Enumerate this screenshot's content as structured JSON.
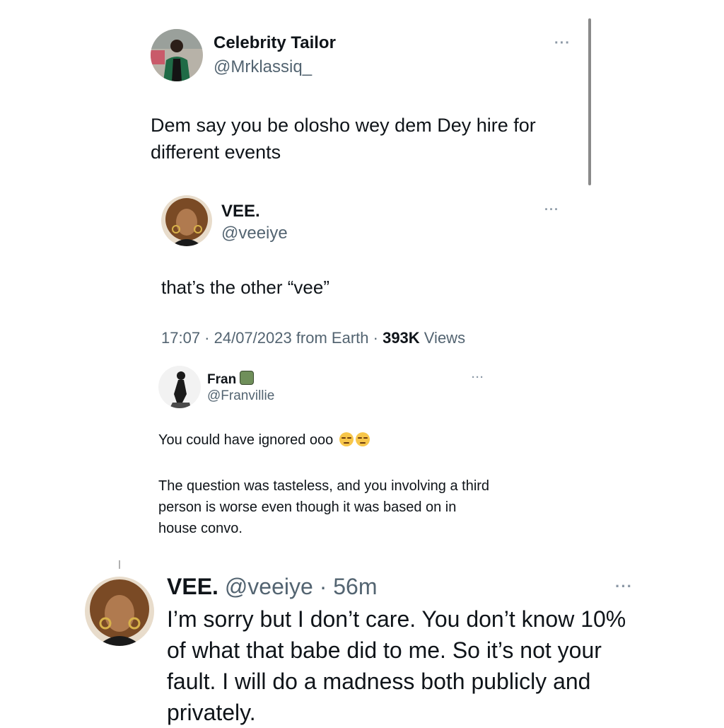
{
  "tweet1": {
    "name": "Celebrity Tailor",
    "handle": "@Mrklassiq_",
    "text": "Dem say you be olosho wey dem Dey hire for different events",
    "more_icon": "more-horizontal-icon"
  },
  "tweet2": {
    "name": "VEE.",
    "handle": "@veeiye",
    "text": "that’s the other “vee”",
    "meta_prefix": "17:07 · 24/07/2023 from Earth · ",
    "views_count": "393K",
    "views_label": " Views"
  },
  "tweet3": {
    "name": "Fran",
    "handle": "@Franvillie",
    "line1": "You could have ignored ooo",
    "line2": "The question was tasteless, and you involving a third person is worse even though it was based on in house convo."
  },
  "tweet4": {
    "name": "VEE.",
    "handle": "@veeiye",
    "time": "· 56m",
    "text": "I’m sorry but I don’t care. You don’t know 10% of what that babe did to me. So it’s not your fault. I will do a madness both publicly and privately."
  },
  "colors": {
    "text": "#0f1419",
    "secondary": "#536471",
    "background": "#ffffff"
  }
}
